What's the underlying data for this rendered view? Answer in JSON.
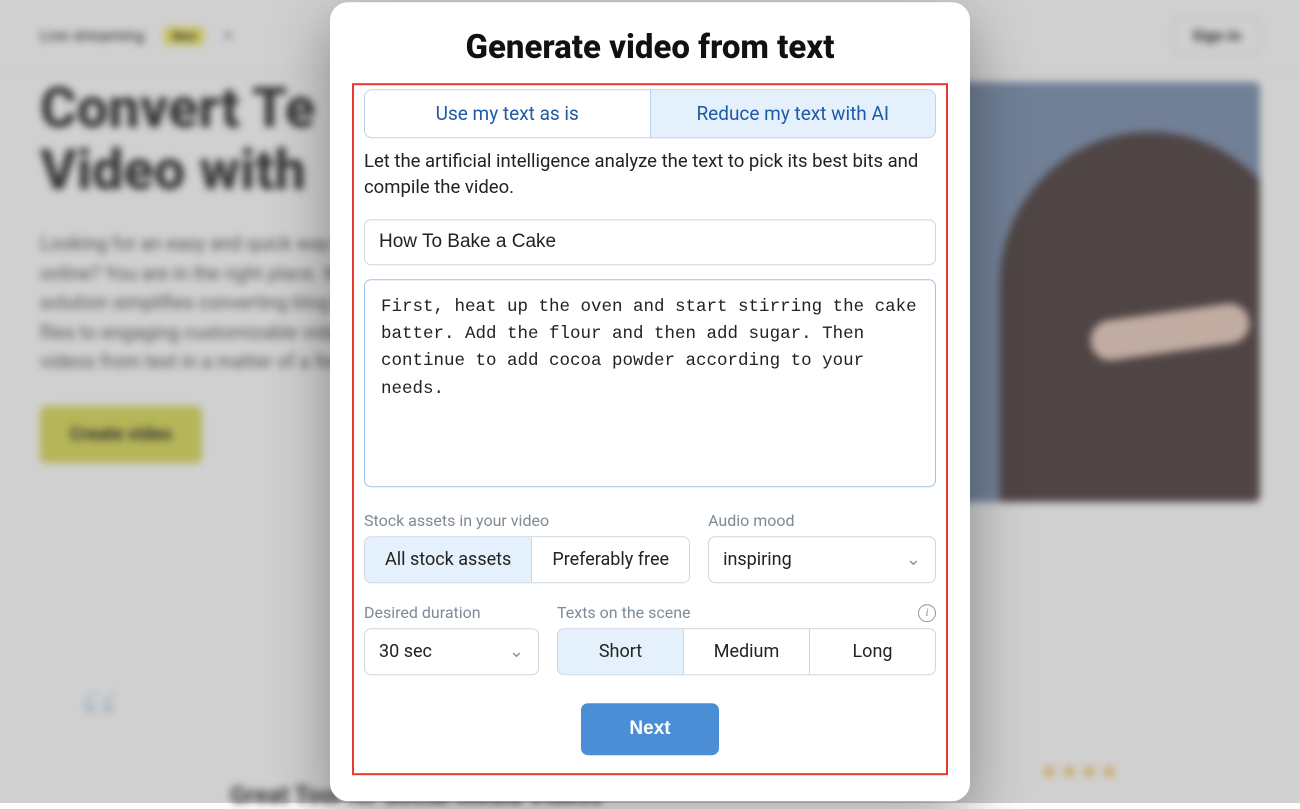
{
  "bg": {
    "nav_item": "Live streaming",
    "nav_badge": "New",
    "signin": "Sign in",
    "hero_title_l1": "Convert Te",
    "hero_title_l2": "Video with",
    "hero_para": "Looking for an easy and quick way to turn text into video online? You are in the right place. Wave.video's AI-powered solution simplifies converting blog posts, articles, and text files to engaging customizable video content online. Create videos from text in a matter of a few clicks!",
    "cta": "Create video",
    "quote_mark": "“",
    "testimonial": "Great Tool for Social Media Videos",
    "stars": "★★★★"
  },
  "modal": {
    "title": "Generate video from text",
    "tabs": {
      "use_as_is": "Use my text as is",
      "reduce_ai": "Reduce my text with AI"
    },
    "description": "Let the artificial intelligence analyze the text to pick its best bits and compile the video.",
    "title_value": "How To Bake a Cake",
    "body_value": "First, heat up the oven and start stirring the cake batter. Add the flour and then add sugar. Then continue to add cocoa powder according to your needs.",
    "stock": {
      "label": "Stock assets in your video",
      "all": "All stock assets",
      "free": "Preferably free"
    },
    "audio": {
      "label": "Audio mood",
      "value": "inspiring"
    },
    "duration": {
      "label": "Desired duration",
      "value": "30 sec"
    },
    "texts": {
      "label": "Texts on the scene",
      "short": "Short",
      "medium": "Medium",
      "long": "Long"
    },
    "next": "Next"
  }
}
